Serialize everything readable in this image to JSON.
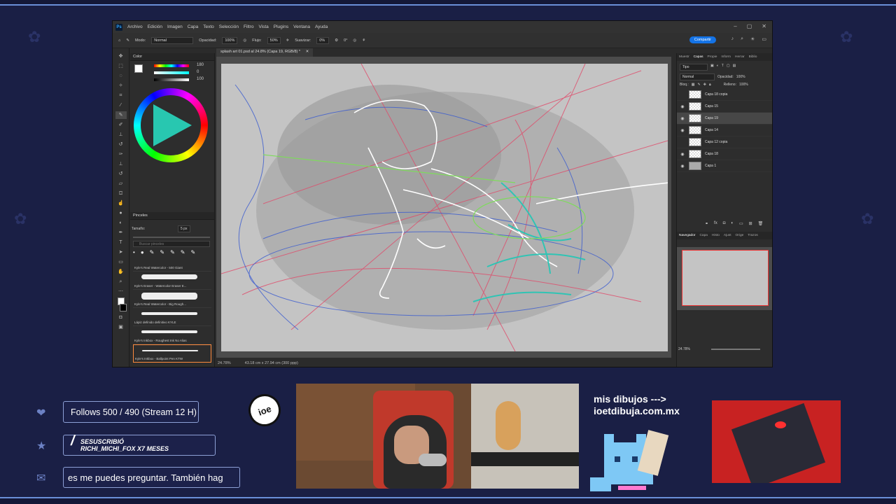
{
  "photoshop": {
    "menu": [
      "Archivo",
      "Edición",
      "Imagen",
      "Capa",
      "Texto",
      "Selección",
      "Filtro",
      "Vista",
      "Plugins",
      "Ventana",
      "Ayuda"
    ],
    "options": {
      "mode_label": "Modo:",
      "mode_value": "Normal",
      "opacity_label": "Opacidad:",
      "opacity_value": "100%",
      "flow_label": "Flujo:",
      "flow_value": "50%",
      "smoothing_label": "Suavizar:",
      "smoothing_value": "0%",
      "angle_value": "0°",
      "share_label": "Compartir"
    },
    "color_panel": {
      "tab": "Color",
      "values": [
        "180",
        "0",
        "100"
      ]
    },
    "brushes_panel": {
      "tab": "Pinceles",
      "size_label": "Tamaño:",
      "size_value": "5 px",
      "search_placeholder": "Buscar pinceles",
      "items": [
        "Kyle's Real Watercolor - 500 Giant",
        "Kyle's Eraser - Watercolor Eraser E...",
        "Kyle's Real Watercolor - Big Rough...",
        "Lápiz definido definitivo KYLE",
        "Kyle's Inkbox - Roughest Ink No Alias",
        "Kyle's Inkbox - Ballpoint Pen KTW"
      ]
    },
    "document_tab": "splash art 01.psd al 24.8% (Capa 19, RGB/8) *",
    "status": {
      "zoom": "24.78%",
      "size": "43.18 cm x 27.94 cm (300 ppp)"
    },
    "layers_panel": {
      "tabs": [
        "Muestr",
        "Capas",
        "Propie",
        "Inform",
        "Herrar",
        "Biblio"
      ],
      "kind": "Tipo",
      "blend": "Normal",
      "opacity_label": "Opacidad:",
      "opacity_value": "100%",
      "lock_label": "Bloq.:",
      "fill_label": "Relleno:",
      "fill_value": "100%",
      "layers": [
        {
          "name": "Capa 18 copia",
          "visible": false
        },
        {
          "name": "Capa 15",
          "visible": true
        },
        {
          "name": "Capa 19",
          "visible": true
        },
        {
          "name": "Capa 14",
          "visible": true
        },
        {
          "name": "Capa 12 copia",
          "visible": false
        },
        {
          "name": "Capa 18",
          "visible": true
        },
        {
          "name": "Capa 1",
          "visible": true
        }
      ]
    },
    "navigator_panel": {
      "tabs": [
        "Navegador",
        "Capa",
        "Histo",
        "Ajust",
        "Orige",
        "Trazos"
      ],
      "zoom": "24.78%"
    }
  },
  "overlay": {
    "follows": "Follows 500 / 490 (Stream 12 H)",
    "sub_title": "SESUSCRIBIÓ",
    "sub_user": "RICHI_MICHI_FOX X7 MESES",
    "ticker": "es me puedes preguntar. También hag",
    "logo_text": "ioe",
    "mis_dibujos_line1": "mis dibujos --->",
    "mis_dibujos_line2": "ioetdibuja.com.mx"
  },
  "colors": {
    "background": "#1a1f45",
    "frame": "#6a8fd8",
    "ps_accent": "#1473e6",
    "selected_brush_border": "#ff8a3d"
  }
}
